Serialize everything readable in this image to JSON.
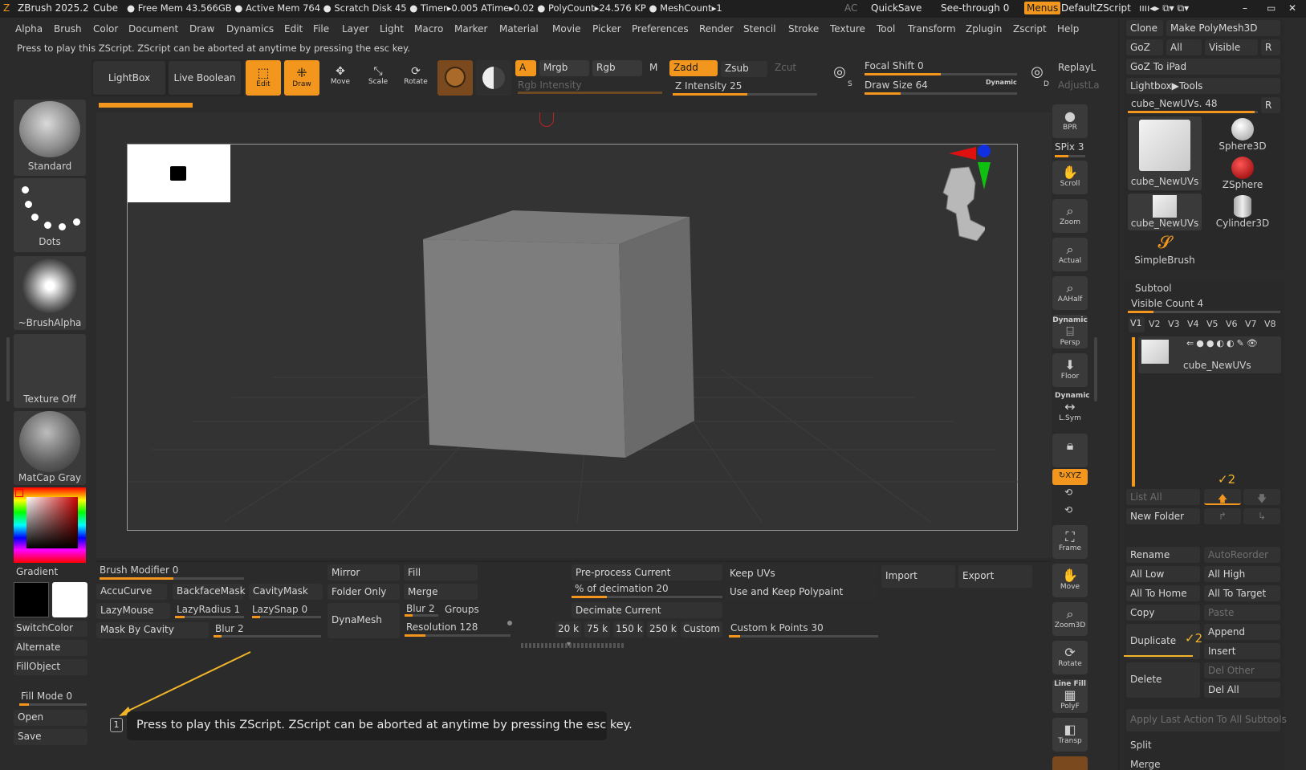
{
  "titlebar": {
    "app": "ZBrush 2025.2",
    "doc": "Cube",
    "stats": "● Free Mem 43.566GB ● Active Mem 764 ● Scratch Disk 45 ● Timer▸0.005 ATime▸0.02 ● PolyCount▸24.576 KP ● MeshCount▸1",
    "ac": "AC",
    "quicksave": "QuickSave",
    "seethrough": "See-through",
    "seethrough_val": "0",
    "menus": "Menus",
    "defaultzscript": "DefaultZScript"
  },
  "menu": [
    "Alpha",
    "Brush",
    "Color",
    "Document",
    "Draw",
    "Dynamics",
    "Edit",
    "File",
    "Layer",
    "Light",
    "Macro",
    "Marker",
    "Material",
    "Movie",
    "Picker",
    "Preferences",
    "Render",
    "Stencil",
    "Stroke",
    "Texture",
    "Tool",
    "Transform",
    "Zplugin",
    "Zscript",
    "Help"
  ],
  "hint": "Press to play this ZScript. ZScript can be aborted at anytime by pressing the esc key.",
  "toolbar": {
    "lightbox": "LightBox",
    "liveboolean": "Live Boolean",
    "edit": "Edit",
    "draw": "Draw",
    "move": "Move",
    "scale": "Scale",
    "rotate": "Rotate",
    "a": "A",
    "mrgb": "Mrgb",
    "rgb": "Rgb",
    "m": "M",
    "zadd": "Zadd",
    "zsub": "Zsub",
    "zcut": "Zcut",
    "rgbintensity": "Rgb Intensity",
    "zintensity": "Z Intensity",
    "zintensity_val": "25",
    "focalshift": "Focal Shift",
    "focalshift_val": "0",
    "drawsize": "Draw Size",
    "drawsize_val": "64",
    "dynamic": "Dynamic",
    "replaylast": "ReplayL",
    "adjustlast": "AdjustLa",
    "s": "S",
    "d": "D"
  },
  "left": {
    "brush": "Standard",
    "stroke": "Dots",
    "alpha": "~BrushAlpha",
    "texture": "Texture Off",
    "material": "MatCap Gray",
    "gradient": "Gradient",
    "switchcolor": "SwitchColor",
    "alternate": "Alternate",
    "fillobject": "FillObject",
    "fillmode": "Fill Mode",
    "fillmode_val": "0",
    "open": "Open",
    "save": "Save"
  },
  "rightshelf": {
    "bpr": "BPR",
    "spix": "SPix",
    "spix_val": "3",
    "scroll": "Scroll",
    "zoom": "Zoom",
    "actual": "Actual",
    "aahalf": "AAHalf",
    "dynamic": "Dynamic",
    "persp": "Persp",
    "floor": "Floor",
    "dynamic2": "Dynamic",
    "lsym": "L.Sym",
    "xyz": "XYZ",
    "frame": "Frame",
    "move": "Move",
    "zoom3d": "Zoom3D",
    "rotate": "Rotate",
    "linefill": "Line Fill",
    "polyf": "PolyF",
    "transp": "Transp"
  },
  "bottom": {
    "brushmod": "Brush Modifier",
    "brushmod_val": "0",
    "accucurve": "AccuCurve",
    "backfacemask": "BackfaceMask",
    "cavitymask": "CavityMask",
    "lazymouse": "LazyMouse",
    "lazyradius": "LazyRadius",
    "lazyradius_val": "1",
    "lazysnap": "LazySnap",
    "lazysnap_val": "0",
    "maskbycavity": "Mask By Cavity",
    "blur": "Blur",
    "blur_val": "2",
    "mirror": "Mirror",
    "folderonly": "Folder Only",
    "dynamesh": "DynaMesh",
    "fill": "Fill",
    "merge": "Merge",
    "blur2": "Blur",
    "blur2_val": "2",
    "groups": "Groups",
    "resolution": "Resolution",
    "resolution_val": "128",
    "preprocess": "Pre-process Current",
    "pctdecimation": "% of decimation",
    "pctdecimation_val": "20",
    "decimatecurrent": "Decimate Current",
    "k20": "20 k",
    "k75": "75 k",
    "k150": "150 k",
    "k250": "250 k",
    "custom": "Custom",
    "customk": "Custom k Points",
    "customk_val": "30",
    "keepuvs": "Keep UVs",
    "usekeep": "Use and Keep Polypaint",
    "import": "Import",
    "export": "Export"
  },
  "tip": {
    "num": "1",
    "text": "Press to play this ZScript. ZScript can be aborted at anytime by pressing the esc key."
  },
  "tool": {
    "clone": "Clone",
    "makepolymesh": "Make PolyMesh3D",
    "goz": "GoZ",
    "all": "All",
    "visible": "Visible",
    "r": "R",
    "goztoipad": "GoZ To iPad",
    "lightboxtools": "Lightbox▶Tools",
    "current": "cube_NewUVs.",
    "current_val": "48",
    "items": [
      "cube_NewUVs",
      "Sphere3D",
      "ZSphere",
      "cube_NewUVs",
      "Cylinder3D",
      "SimpleBrush"
    ]
  },
  "subtool": {
    "title": "Subtool",
    "visiblecount": "Visible Count",
    "visiblecount_val": "4",
    "views": [
      "V1",
      "V2",
      "V3",
      "V4",
      "V5",
      "V6",
      "V7",
      "V8"
    ],
    "item": "cube_NewUVs",
    "listall": "List All",
    "newfolder": "New Folder",
    "rename": "Rename",
    "autoreorder": "AutoReorder",
    "alllow": "All Low",
    "allhigh": "All High",
    "alltohome": "All To Home",
    "alltotarget": "All To Target",
    "copy": "Copy",
    "paste": "Paste",
    "duplicate": "Duplicate",
    "append": "Append",
    "insert": "Insert",
    "delete": "Delete",
    "delother": "Del Other",
    "delall": "Del All",
    "applylast": "Apply Last Action To All Subtools",
    "split": "Split",
    "merge": "Merge"
  },
  "colors": {
    "accent": "#f2961e",
    "bg": "#2b2b2b",
    "canvas": "#333333"
  }
}
